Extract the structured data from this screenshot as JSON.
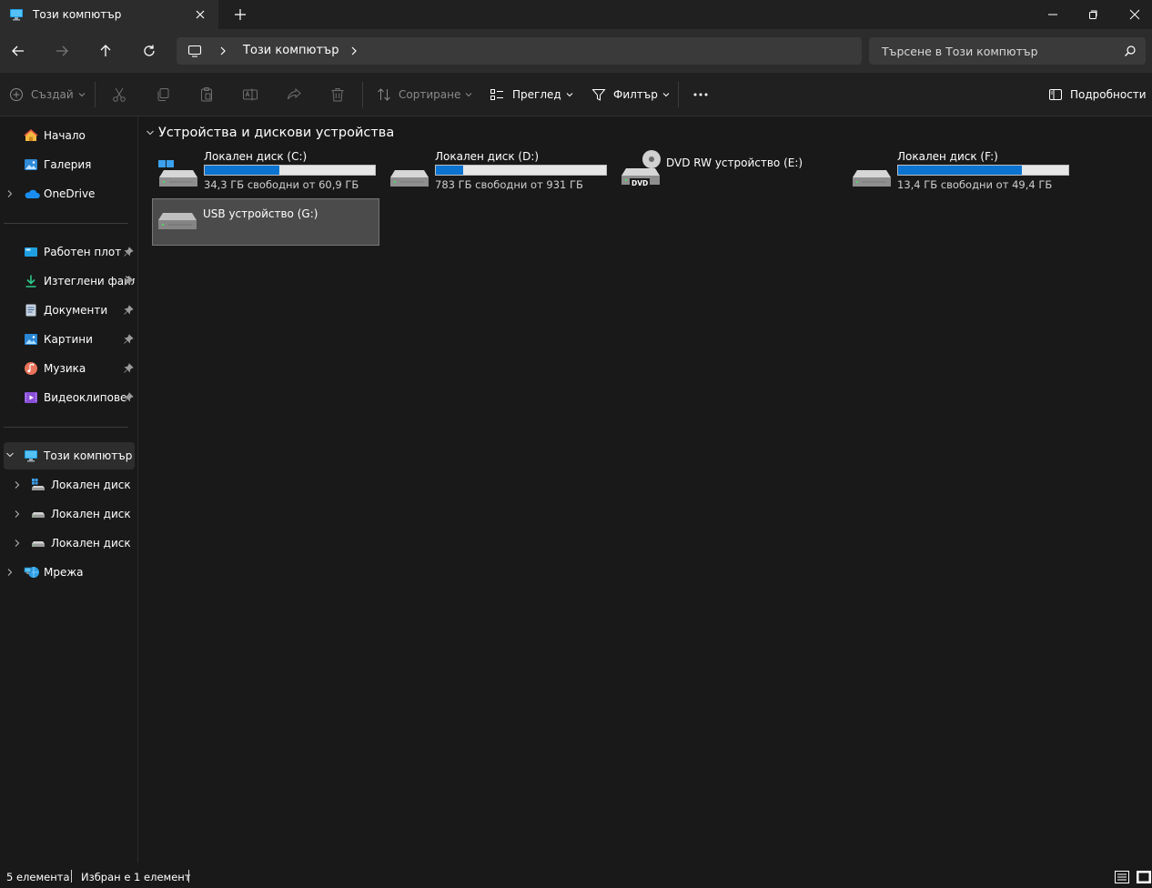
{
  "tab": {
    "title": "Този компютър"
  },
  "address": {
    "crumb": "Този компютър"
  },
  "search": {
    "placeholder": "Търсене в Този компютър"
  },
  "toolbar": {
    "create": "Създай",
    "sort": "Сортиране",
    "view": "Преглед",
    "filter": "Филтър",
    "details": "Подробности"
  },
  "sidebar": {
    "quick": [
      {
        "label": "Начало",
        "icon": "home-icon"
      },
      {
        "label": "Галерия",
        "icon": "gallery-icon"
      },
      {
        "label": "OneDrive",
        "icon": "onedrive-icon"
      }
    ],
    "pinned": [
      {
        "label": "Работен плот",
        "icon": "desktop-icon"
      },
      {
        "label": "Изтеглени файлове",
        "icon": "downloads-icon"
      },
      {
        "label": "Документи",
        "icon": "documents-icon"
      },
      {
        "label": "Картини",
        "icon": "pictures-icon"
      },
      {
        "label": "Музика",
        "icon": "music-icon"
      },
      {
        "label": "Видеоклипове",
        "icon": "videos-icon"
      }
    ],
    "this_pc": {
      "label": "Този компютър"
    },
    "drives": [
      {
        "label": "Локален диск (C:)"
      },
      {
        "label": "Локален диск (D:)"
      },
      {
        "label": "Локален диск (F:)"
      }
    ],
    "network": {
      "label": "Мрежа"
    }
  },
  "content": {
    "group_title": "Устройства и дискови устройства",
    "drives": [
      {
        "name": "Локален диск (C:)",
        "free": "34,3 ГБ свободни от 60,9 ГБ",
        "used_fraction": 0.437,
        "icon": "system-drive-icon"
      },
      {
        "name": "Локален диск (D:)",
        "free": "783 ГБ свободни от 931 ГБ",
        "used_fraction": 0.159,
        "icon": "hard-drive-icon"
      },
      {
        "name": "DVD RW устройство (E:)",
        "icon": "dvd-drive-icon",
        "dvd_label": "DVD"
      },
      {
        "name": "Локален диск (F:)",
        "free": "13,4 ГБ свободни от 49,4 ГБ",
        "used_fraction": 0.729,
        "icon": "hard-drive-icon"
      },
      {
        "name": "USB устройство (G:)",
        "icon": "usb-drive-icon",
        "selected": true
      }
    ]
  },
  "status": {
    "count": "5 елемента",
    "selected": "Избран е 1 елемент"
  },
  "colors": {
    "accent": "#0b74d1",
    "background": "#191919",
    "toolbar": "#202020"
  }
}
